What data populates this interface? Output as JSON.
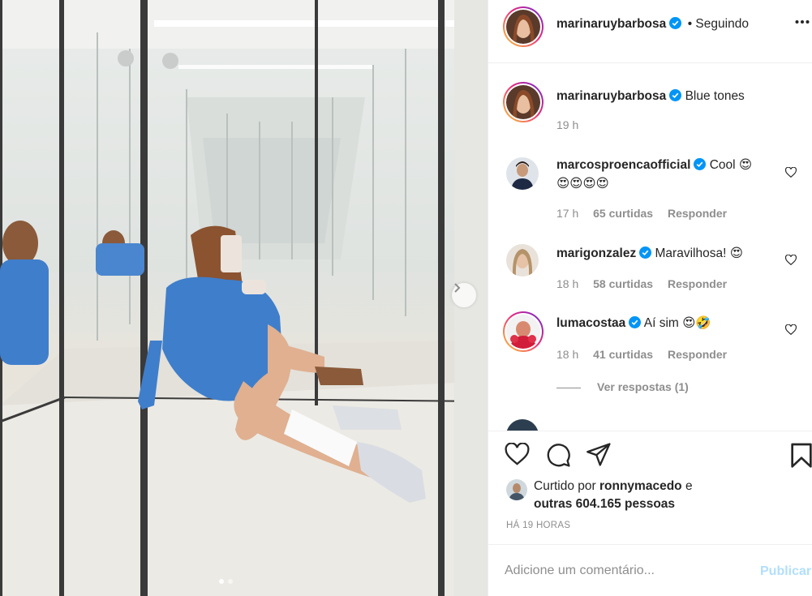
{
  "post": {
    "author": "marinaruybarbosa",
    "follow_status": "• Seguindo",
    "caption": "Blue tones",
    "caption_time": "19 h",
    "carousel_position": 0,
    "carousel_total": 2
  },
  "comments": [
    {
      "username": "marcosproencaofficial",
      "text": "Cool 😍",
      "text_line2": "😍😍😍😍",
      "time": "17 h",
      "likes": "65 curtidas",
      "reply": "Responder",
      "verified": true
    },
    {
      "username": "marigonzalez",
      "text": "Maravilhosa! 😍",
      "time": "18 h",
      "likes": "58 curtidas",
      "reply": "Responder",
      "verified": true
    },
    {
      "username": "lumacostaa",
      "text": "Aí sim 😍🤣",
      "time": "18 h",
      "likes": "41 curtidas",
      "reply": "Responder",
      "verified": true
    }
  ],
  "view_replies": "Ver respostas (1)",
  "likes_summary": {
    "prefix": "Curtido por",
    "user": "ronnymacedo",
    "conj": "e",
    "others": "outras 604.165 pessoas"
  },
  "time_ago": "HÁ 19 HORAS",
  "comment_input": {
    "placeholder": "Adicione um comentário...",
    "value": ""
  },
  "publish_label": "Publicar",
  "colors": {
    "verified": "#0095f6",
    "publish_disabled": "#b2dffc",
    "meta_gray": "#8e8e8e",
    "sweater_blue": "#3f7ecb"
  },
  "icons": [
    "more-icon",
    "heart-icon",
    "comment-icon",
    "share-icon",
    "save-icon",
    "chevron-right-icon",
    "verified-icon"
  ]
}
